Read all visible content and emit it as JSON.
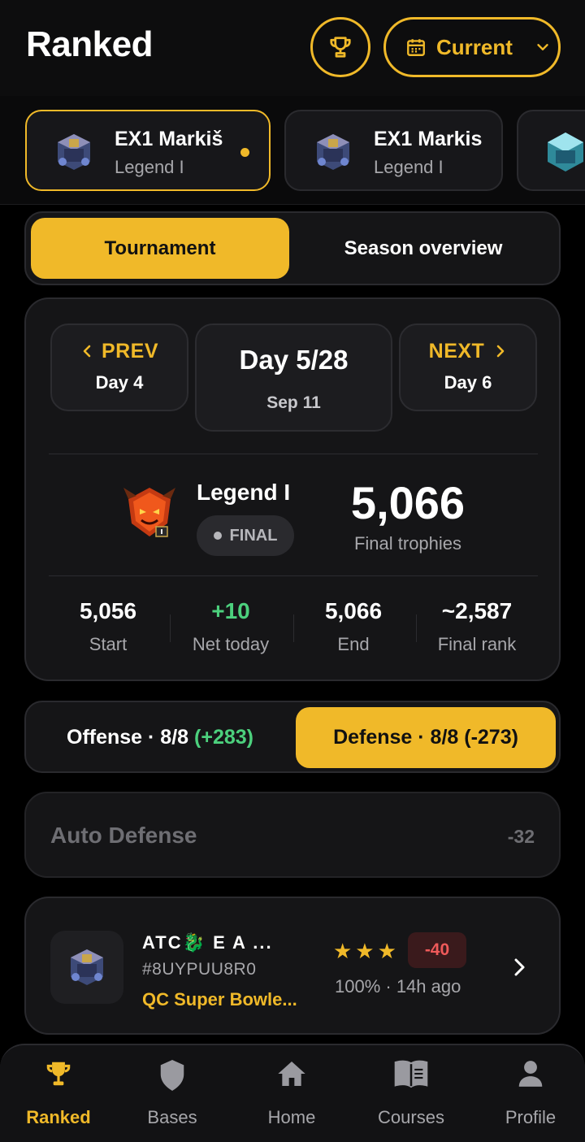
{
  "header": {
    "title": "Ranked",
    "trophy_icon": "trophy-icon",
    "period_label": "Current",
    "period_icon": "calendar-icon"
  },
  "accounts": [
    {
      "name": "EX1 Markiš",
      "league": "Legend I",
      "active": true
    },
    {
      "name": "EX1 Markis",
      "league": "Legend I",
      "active": false
    },
    {
      "name": "",
      "league": "",
      "active": false
    }
  ],
  "view_tabs": {
    "tournament": "Tournament",
    "season": "Season overview",
    "selected": "Tournament"
  },
  "day_nav": {
    "prev_label": "PREV",
    "prev_day": "Day 4",
    "current_title": "Day 5/28",
    "current_date": "Sep 11",
    "next_label": "NEXT",
    "next_day": "Day 6"
  },
  "summary": {
    "league": "Legend I",
    "status": "FINAL",
    "trophies": "5,066",
    "trophies_label": "Final trophies"
  },
  "stats": [
    {
      "value": "5,056",
      "label": "Start",
      "color": "#ffffff"
    },
    {
      "value": "+10",
      "label": "Net today",
      "color": "#4cd07d"
    },
    {
      "value": "5,066",
      "label": "End",
      "color": "#ffffff"
    },
    {
      "value": "~2,587",
      "label": "Final rank",
      "color": "#ffffff"
    }
  ],
  "mode_tabs": {
    "offense_label": "Offense · 8/8",
    "offense_delta": "(+283)",
    "defense_label": "Defense · 8/8 (-273)",
    "selected": "defense"
  },
  "auto_defense": {
    "label": "Auto Defense",
    "value": "-32"
  },
  "attack": {
    "name": "ATC🐉 E A ...",
    "tag": "#8UYPUU8R0",
    "clan": "QC Super Bowle...",
    "stars": "★★★",
    "delta": "-40",
    "meta": "100% · 14h ago"
  },
  "tabbar": [
    {
      "label": "Ranked",
      "icon": "trophy-icon",
      "active": true
    },
    {
      "label": "Bases",
      "icon": "shield-icon",
      "active": false
    },
    {
      "label": "Home",
      "icon": "home-icon",
      "active": false
    },
    {
      "label": "Courses",
      "icon": "book-icon",
      "active": false
    },
    {
      "label": "Profile",
      "icon": "person-icon",
      "active": false
    }
  ],
  "colors": {
    "accent": "#f0b929",
    "positive": "#4cd07d",
    "negative": "#ef5a5a",
    "background": "#000000",
    "card": "#151517"
  }
}
